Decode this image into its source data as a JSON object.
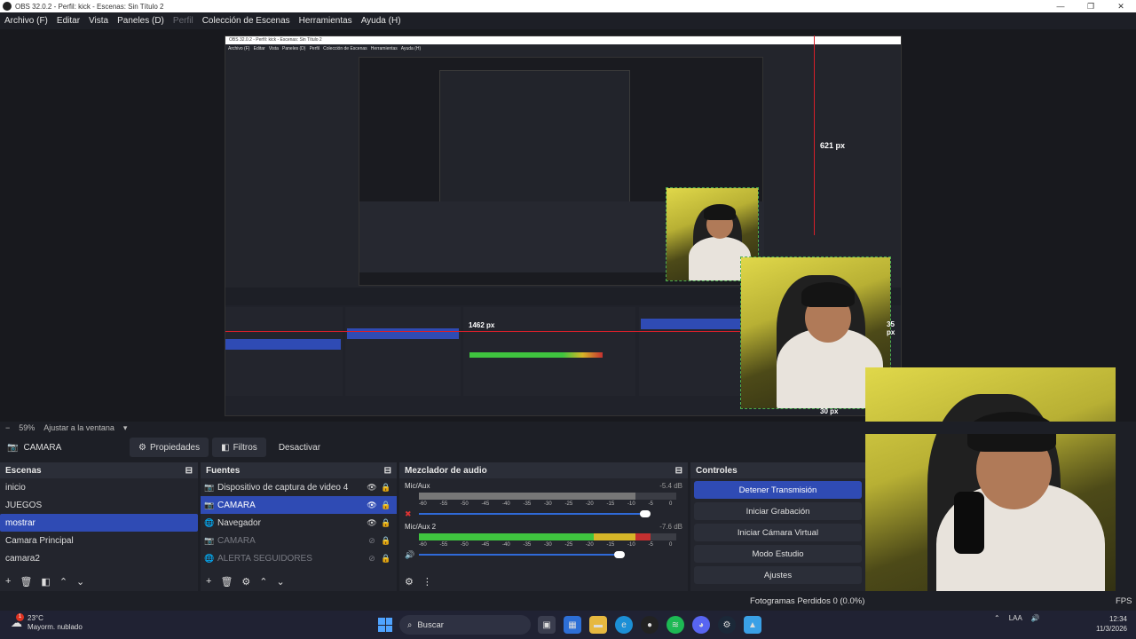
{
  "window": {
    "title": "OBS 32.0.2 - Perfil: kick - Escenas: Sin Título 2",
    "controls": [
      "—",
      "❐",
      "✕"
    ]
  },
  "menu": {
    "items": [
      {
        "label": "Archivo (F)",
        "dim": false
      },
      {
        "label": "Editar",
        "dim": false
      },
      {
        "label": "Vista",
        "dim": false
      },
      {
        "label": "Paneles (D)",
        "dim": false
      },
      {
        "label": "Perfil",
        "dim": true
      },
      {
        "label": "Colección de Escenas",
        "dim": false
      },
      {
        "label": "Herramientas",
        "dim": false
      },
      {
        "label": "Ayuda (H)",
        "dim": false
      }
    ]
  },
  "preview": {
    "measures": [
      "621 px",
      "35 px",
      "30 px",
      "1462 px"
    ]
  },
  "zoom": {
    "value": "59%",
    "fit_label": "Ajustar a la ventana"
  },
  "source_toolbar": {
    "current_source": "CAMARA",
    "properties_label": "Propiedades",
    "filters_label": "Filtros",
    "deactivate_label": "Desactivar"
  },
  "scenes": {
    "title": "Escenas",
    "items": [
      {
        "label": "inicio",
        "selected": false
      },
      {
        "label": "JUEGOS",
        "selected": false
      },
      {
        "label": "mostrar",
        "selected": true
      },
      {
        "label": "Camara Principal",
        "selected": false
      },
      {
        "label": "camara2",
        "selected": false
      }
    ]
  },
  "sources": {
    "title": "Fuentes",
    "items": [
      {
        "label": "Dispositivo de captura de video 4",
        "visible": true,
        "selected": false,
        "enabled": true
      },
      {
        "label": "CAMARA",
        "visible": true,
        "selected": true,
        "enabled": true
      },
      {
        "label": "Navegador",
        "visible": true,
        "selected": false,
        "enabled": true
      },
      {
        "label": "CAMARA",
        "visible": false,
        "selected": false,
        "enabled": false
      },
      {
        "label": "ALERTA SEGUIDORES",
        "visible": false,
        "selected": false,
        "enabled": false
      }
    ]
  },
  "mixer": {
    "title": "Mezclador de audio",
    "ticks": [
      "-60",
      "-55",
      "-50",
      "-45",
      "-40",
      "-35",
      "-30",
      "-25",
      "-20",
      "-15",
      "-10",
      "-5",
      "0"
    ],
    "channels": [
      {
        "name": "Mic/Aux",
        "db": "-5.4 dB",
        "level": 0.0,
        "volume": 0.88,
        "muted": true
      },
      {
        "name": "Mic/Aux 2",
        "db": "-7.6 dB",
        "level": 0.9,
        "volume": 0.78,
        "muted": false
      }
    ]
  },
  "controls": {
    "title": "Controles",
    "buttons": [
      {
        "label": "Detener Transmisión",
        "active": true
      },
      {
        "label": "Iniciar Grabación",
        "active": false
      },
      {
        "label": "Iniciar Cámara Virtual",
        "active": false
      },
      {
        "label": "Modo Estudio",
        "active": false
      },
      {
        "label": "Ajustes",
        "active": false
      }
    ]
  },
  "status": {
    "dropped_frames": "Fotogramas Perdidos 0 (0.0%)",
    "fps": "FPS"
  },
  "taskbar": {
    "weather_temp": "23°C",
    "weather_desc": "Mayorm. nublado",
    "weather_badge": "1",
    "search_placeholder": "Buscar",
    "lang": "LAA",
    "time": "12:34",
    "date": "11/3/2026"
  },
  "colors": {
    "accent": "#2f4bb4",
    "red_guide": "#d8202a",
    "meter_green": "#3fc43f",
    "meter_yellow": "#d6b628",
    "meter_red": "#c43030"
  }
}
